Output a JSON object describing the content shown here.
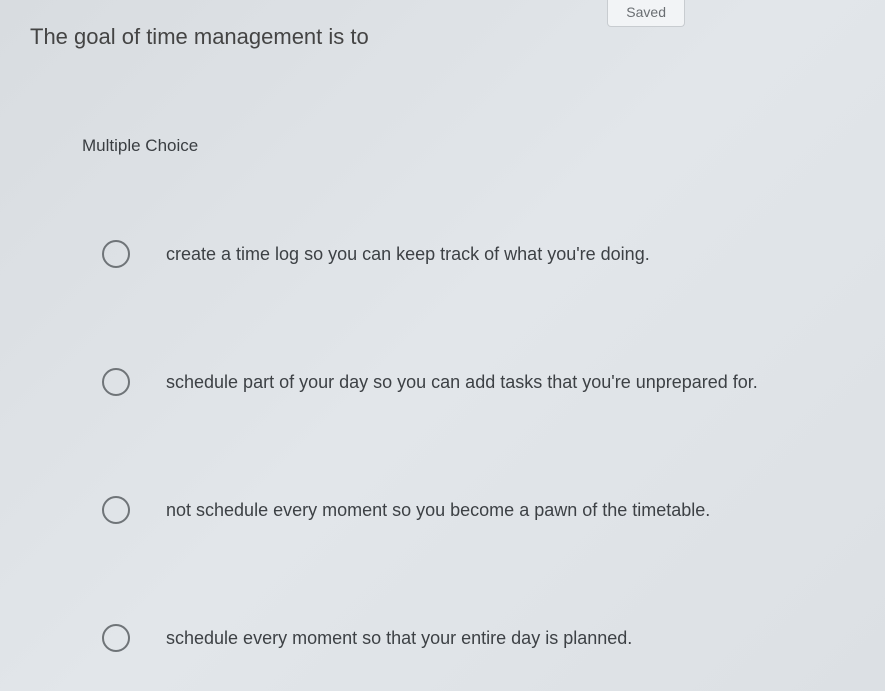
{
  "status": {
    "saved_label": "Saved"
  },
  "question": {
    "stem": "The goal of time management is to",
    "type_label": "Multiple Choice",
    "options": [
      {
        "text": "create a time log so you can keep track of what you're doing."
      },
      {
        "text": "schedule part of your day so you can add tasks that you're unprepared for."
      },
      {
        "text": "not schedule every moment so you become a pawn of the timetable."
      },
      {
        "text": "schedule every moment so that your entire day is planned."
      }
    ]
  }
}
